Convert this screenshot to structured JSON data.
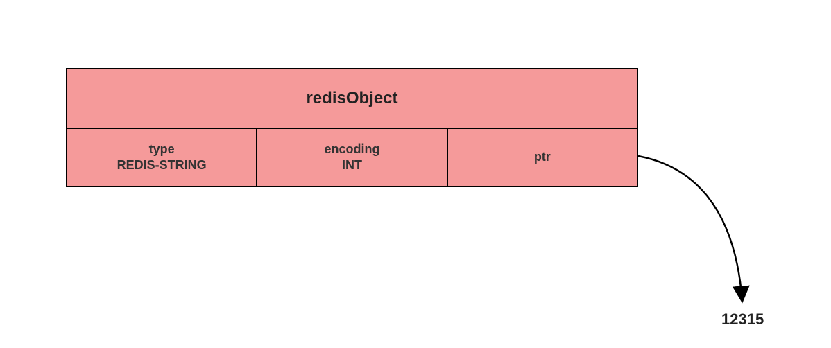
{
  "struct": {
    "title": "redisObject",
    "fields": [
      {
        "label": "type",
        "value": "REDIS-STRING"
      },
      {
        "label": "encoding",
        "value": "INT"
      },
      {
        "label": "ptr",
        "value": ""
      }
    ]
  },
  "pointerTarget": "12315"
}
